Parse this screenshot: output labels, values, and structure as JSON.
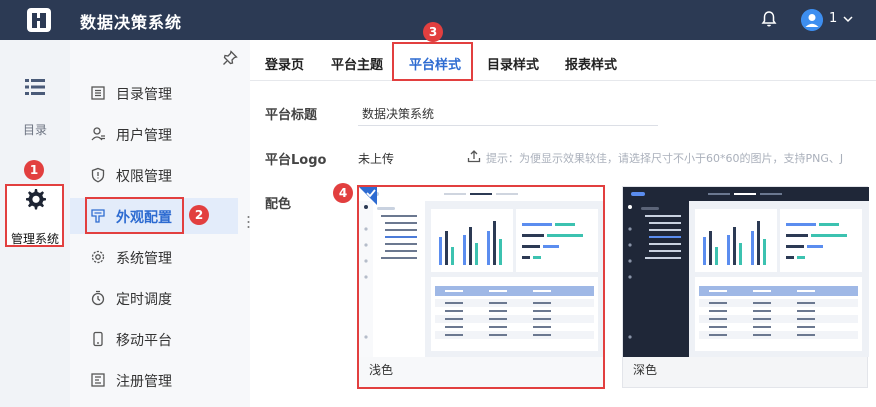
{
  "app": {
    "title": "数据决策系统",
    "user_name": "1"
  },
  "rail": {
    "directory_label": "目录",
    "management_label": "管理系统"
  },
  "menu": {
    "items": [
      {
        "label": "目录管理",
        "icon": "catalog-icon"
      },
      {
        "label": "用户管理",
        "icon": "user-icon"
      },
      {
        "label": "权限管理",
        "icon": "shield-icon"
      },
      {
        "label": "外观配置",
        "icon": "appearance-icon"
      },
      {
        "label": "系统管理",
        "icon": "gear-icon"
      },
      {
        "label": "定时调度",
        "icon": "timer-icon"
      },
      {
        "label": "移动平台",
        "icon": "mobile-icon"
      },
      {
        "label": "注册管理",
        "icon": "register-icon"
      }
    ],
    "active_index": 3
  },
  "tabs": [
    "登录页",
    "平台主题",
    "平台样式",
    "目录样式",
    "报表样式"
  ],
  "active_tab": 2,
  "form": {
    "title_label": "平台标题",
    "title_value": "数据决策系统",
    "logo_label": "平台Logo",
    "logo_status": "未上传",
    "logo_hint": "提示：为便显示效果较佳，请选择尺寸不小于60*60的图片，支持PNG、J",
    "color_label": "配色"
  },
  "schemes": [
    {
      "label": "浅色",
      "selected": true
    },
    {
      "label": "深色",
      "selected": false
    }
  ],
  "badges": [
    "1",
    "2",
    "3",
    "4"
  ],
  "colors": {
    "topbar": "#2c3a54",
    "accent": "#2d6bd1",
    "highlight": "#e23f3f"
  }
}
